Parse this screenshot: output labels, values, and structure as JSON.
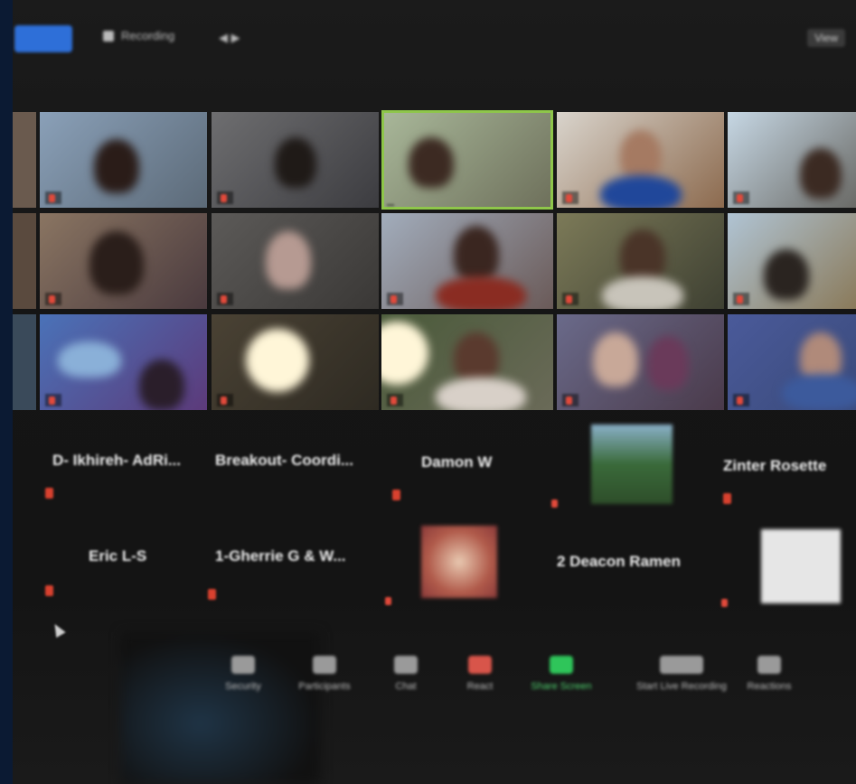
{
  "topbar": {
    "record_label": "",
    "recording_label": "Recording",
    "pager": "◀ ▶",
    "view_label": "View"
  },
  "video_tiles": [
    {
      "name": ""
    },
    {
      "name": ""
    },
    {
      "name": ""
    },
    {
      "name": ""
    },
    {
      "name": ""
    },
    {
      "name": ""
    },
    {
      "name": ""
    },
    {
      "name": ""
    },
    {
      "name": ""
    },
    {
      "name": ""
    },
    {
      "name": ""
    },
    {
      "name": ""
    },
    {
      "name": ""
    },
    {
      "name": ""
    },
    {
      "name": ""
    }
  ],
  "name_tiles": [
    {
      "label": "D- Ikhireh- AdRi..."
    },
    {
      "label": "Breakout- Coordi..."
    },
    {
      "label": "Damon W"
    },
    {
      "label": "Zinter Rosette"
    },
    {
      "label": "Eric L-S"
    },
    {
      "label": "1-Gherrie G & W..."
    },
    {
      "label": "2 Deacon Ramen"
    }
  ],
  "toolbar": {
    "items": [
      {
        "label": "Security"
      },
      {
        "label": "Participants"
      },
      {
        "label": "Chat"
      },
      {
        "label": "React"
      },
      {
        "label": "Share Screen"
      },
      {
        "label": "Start Live Recording"
      },
      {
        "label": "Reactions"
      }
    ]
  },
  "colors": {
    "accent_blue": "#2e6fd8",
    "speaker_border": "#8ec64a",
    "share_green": "#2fc55a",
    "muted_red": "#e24a3b"
  }
}
